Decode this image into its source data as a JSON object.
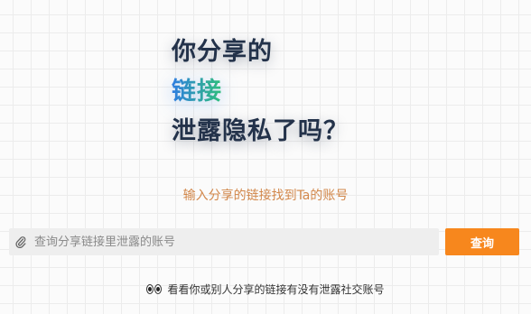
{
  "hero": {
    "line1": "你分享的",
    "line2": "链接",
    "line3": "泄露隐私了吗？"
  },
  "subtitle": "输入分享的链接找到Ta的账号",
  "search": {
    "value": "",
    "placeholder": "查询分享链接里泄露的账号",
    "icon": "paperclip-icon"
  },
  "query_button": {
    "label": "查询"
  },
  "hint": {
    "icon": "eyes-icon",
    "text": "看看你或别人分享的链接有没有泄露社交账号"
  },
  "colors": {
    "accent": "#f7871d",
    "headline": "#23324a",
    "gradient_start": "#2f7de1",
    "gradient_end": "#2fbf7a",
    "subtitle": "#d2874a"
  }
}
